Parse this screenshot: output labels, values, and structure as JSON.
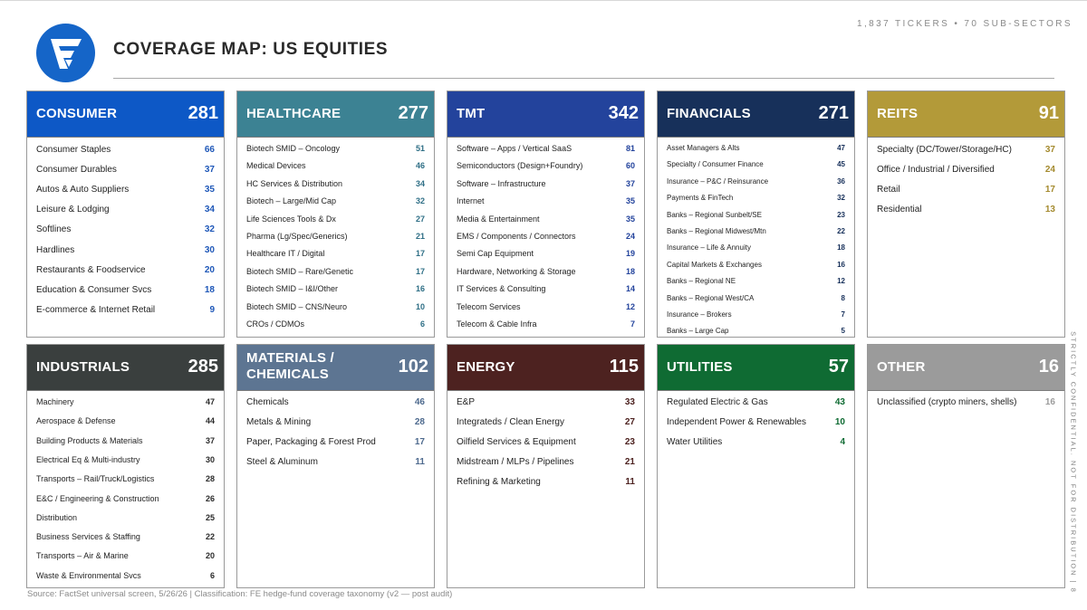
{
  "header": {
    "title": "COVERAGE MAP: US EQUITIES",
    "ticker_summary": "1,837 TICKERS  •  70 SUB-SECTORS"
  },
  "logo": {
    "icon": "fe-logo-icon",
    "color": "#1565c8"
  },
  "sectors": [
    {
      "name": "CONSUMER",
      "total": "281",
      "head_color": "#0d58c6",
      "value_color": "#1e57b8",
      "rows": [
        {
          "label": "Consumer Staples",
          "value": "66"
        },
        {
          "label": "Consumer Durables",
          "value": "37"
        },
        {
          "label": "Autos & Auto Suppliers",
          "value": "35"
        },
        {
          "label": "Leisure & Lodging",
          "value": "34"
        },
        {
          "label": "Softlines",
          "value": "32"
        },
        {
          "label": "Hardlines",
          "value": "30"
        },
        {
          "label": "Restaurants & Foodservice",
          "value": "20"
        },
        {
          "label": "Education & Consumer Svcs",
          "value": "18"
        },
        {
          "label": "E-commerce & Internet Retail",
          "value": "9"
        }
      ]
    },
    {
      "name": "HEALTHCARE",
      "total": "277",
      "head_color": "#3c8293",
      "value_color": "#2f6f86",
      "rows": [
        {
          "label": "Biotech SMID – Oncology",
          "value": "51"
        },
        {
          "label": "Medical Devices",
          "value": "46"
        },
        {
          "label": "HC Services & Distribution",
          "value": "34"
        },
        {
          "label": "Biotech – Large/Mid Cap",
          "value": "32"
        },
        {
          "label": "Life Sciences Tools & Dx",
          "value": "27"
        },
        {
          "label": "Pharma (Lg/Spec/Generics)",
          "value": "21"
        },
        {
          "label": "Healthcare IT / Digital",
          "value": "17"
        },
        {
          "label": "Biotech SMID – Rare/Genetic",
          "value": "17"
        },
        {
          "label": "Biotech SMID – I&I/Other",
          "value": "16"
        },
        {
          "label": "Biotech SMID – CNS/Neuro",
          "value": "10"
        },
        {
          "label": "CROs / CDMOs",
          "value": "6"
        }
      ]
    },
    {
      "name": "TMT",
      "total": "342",
      "head_color": "#23439c",
      "value_color": "#23439c",
      "rows": [
        {
          "label": "Software – Apps / Vertical SaaS",
          "value": "81"
        },
        {
          "label": "Semiconductors (Design+Foundry)",
          "value": "60"
        },
        {
          "label": "Software – Infrastructure",
          "value": "37"
        },
        {
          "label": "Internet",
          "value": "35"
        },
        {
          "label": "Media & Entertainment",
          "value": "35"
        },
        {
          "label": "EMS / Components / Connectors",
          "value": "24"
        },
        {
          "label": "Semi Cap Equipment",
          "value": "19"
        },
        {
          "label": "Hardware, Networking & Storage",
          "value": "18"
        },
        {
          "label": "IT Services & Consulting",
          "value": "14"
        },
        {
          "label": "Telecom Services",
          "value": "12"
        },
        {
          "label": "Telecom & Cable Infra",
          "value": "7"
        }
      ]
    },
    {
      "name": "FINANCIALS",
      "total": "271",
      "head_color": "#17305a",
      "value_color": "#17305a",
      "rows": [
        {
          "label": "Asset Managers & Alts",
          "value": "47"
        },
        {
          "label": "Specialty / Consumer Finance",
          "value": "45"
        },
        {
          "label": "Insurance – P&C / Reinsurance",
          "value": "36"
        },
        {
          "label": "Payments & FinTech",
          "value": "32"
        },
        {
          "label": "Banks – Regional Sunbelt/SE",
          "value": "23"
        },
        {
          "label": "Banks – Regional Midwest/Mtn",
          "value": "22"
        },
        {
          "label": "Insurance – Life & Annuity",
          "value": "18"
        },
        {
          "label": "Capital Markets & Exchanges",
          "value": "16"
        },
        {
          "label": "Banks – Regional NE",
          "value": "12"
        },
        {
          "label": "Banks – Regional West/CA",
          "value": "8"
        },
        {
          "label": "Insurance – Brokers",
          "value": "7"
        },
        {
          "label": "Banks – Large Cap",
          "value": "5"
        }
      ]
    },
    {
      "name": "REITS",
      "total": "91",
      "head_color": "#b39a39",
      "value_color": "#a48a2e",
      "rows": [
        {
          "label": "Specialty (DC/Tower/Storage/HC)",
          "value": "37"
        },
        {
          "label": "Office / Industrial / Diversified",
          "value": "24"
        },
        {
          "label": "Retail",
          "value": "17"
        },
        {
          "label": "Residential",
          "value": "13"
        }
      ]
    },
    {
      "name": "INDUSTRIALS",
      "total": "285",
      "head_color": "#3a3f3e",
      "value_color": "#2b2b2b",
      "rows": [
        {
          "label": "Machinery",
          "value": "47"
        },
        {
          "label": "Aerospace & Defense",
          "value": "44"
        },
        {
          "label": "Building Products & Materials",
          "value": "37"
        },
        {
          "label": "Electrical Eq & Multi-industry",
          "value": "30"
        },
        {
          "label": "Transports – Rail/Truck/Logistics",
          "value": "28"
        },
        {
          "label": "E&C / Engineering & Construction",
          "value": "26"
        },
        {
          "label": "Distribution",
          "value": "25"
        },
        {
          "label": "Business Services & Staffing",
          "value": "22"
        },
        {
          "label": "Transports – Air & Marine",
          "value": "20"
        },
        {
          "label": "Waste & Environmental Svcs",
          "value": "6"
        }
      ]
    },
    {
      "name": "MATERIALS /\nCHEMICALS",
      "total": "102",
      "head_color": "#5d7592",
      "value_color": "#4e6a8e",
      "rows": [
        {
          "label": "Chemicals",
          "value": "46"
        },
        {
          "label": "Metals & Mining",
          "value": "28"
        },
        {
          "label": "Paper, Packaging & Forest Prod",
          "value": "17"
        },
        {
          "label": "Steel & Aluminum",
          "value": "11"
        }
      ]
    },
    {
      "name": "ENERGY",
      "total": "115",
      "head_color": "#4d2220",
      "value_color": "#4d2220",
      "rows": [
        {
          "label": "E&P",
          "value": "33"
        },
        {
          "label": "Integrateds / Clean Energy",
          "value": "27"
        },
        {
          "label": "Oilfield Services & Equipment",
          "value": "23"
        },
        {
          "label": "Midstream / MLPs / Pipelines",
          "value": "21"
        },
        {
          "label": "Refining & Marketing",
          "value": "11"
        }
      ]
    },
    {
      "name": "UTILITIES",
      "total": "57",
      "head_color": "#0f6b33",
      "value_color": "#0f6b33",
      "rows": [
        {
          "label": "Regulated Electric & Gas",
          "value": "43"
        },
        {
          "label": "Independent Power & Renewables",
          "value": "10"
        },
        {
          "label": "Water Utilities",
          "value": "4"
        }
      ]
    },
    {
      "name": "OTHER",
      "total": "16",
      "head_color": "#9b9b9b",
      "value_color": "#9b9b9b",
      "rows": [
        {
          "label": "Unclassified (crypto miners, shells)",
          "value": "16"
        }
      ]
    }
  ],
  "side_note": "STRICTLY CONFIDENTIAL. NOT FOR DISTRIBUTION  |  8",
  "footer": "Source: FactSet universal screen, 5/26/26  |  Classification: FE hedge-fund coverage taxonomy (v2 — post audit)"
}
